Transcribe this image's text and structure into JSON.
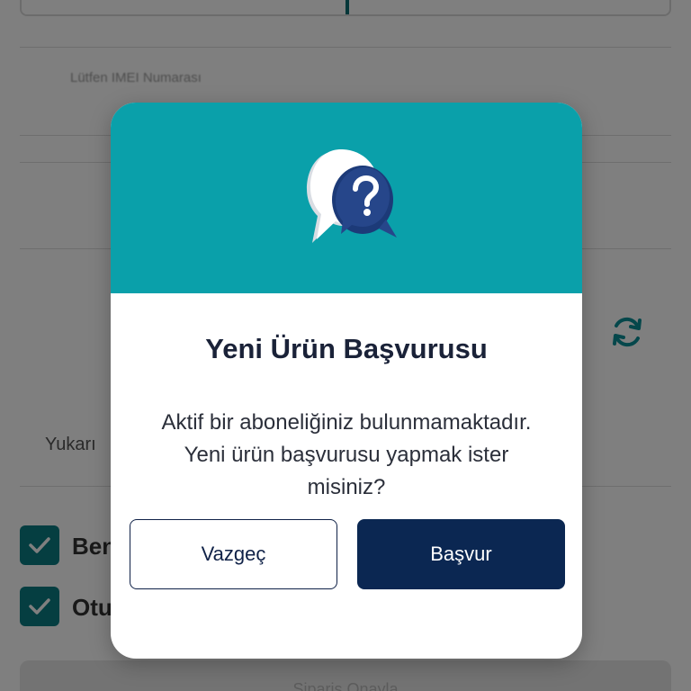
{
  "background": {
    "field_label": "Lütfen IMEI Numarası",
    "upload_text": "Yukarı",
    "checkbox_1_label": "Ben",
    "checkbox_2_label": "Otu",
    "bottom_button_label": "Sipariş Onayla"
  },
  "modal": {
    "icon": "question-chat-bubble-icon",
    "title": "Yeni Ürün Başvurusu",
    "message": "Aktif bir aboneliğiniz bulunmamaktadır. Yeni ürün başvurusu yapmak ister misiniz?",
    "cancel_label": "Vazgeç",
    "apply_label": "Başvur"
  },
  "colors": {
    "header_teal": "#0aa0aa",
    "primary_navy": "#0b2752",
    "check_teal": "#0a7d83",
    "overlay": "rgba(0,0,0,0.5)"
  }
}
